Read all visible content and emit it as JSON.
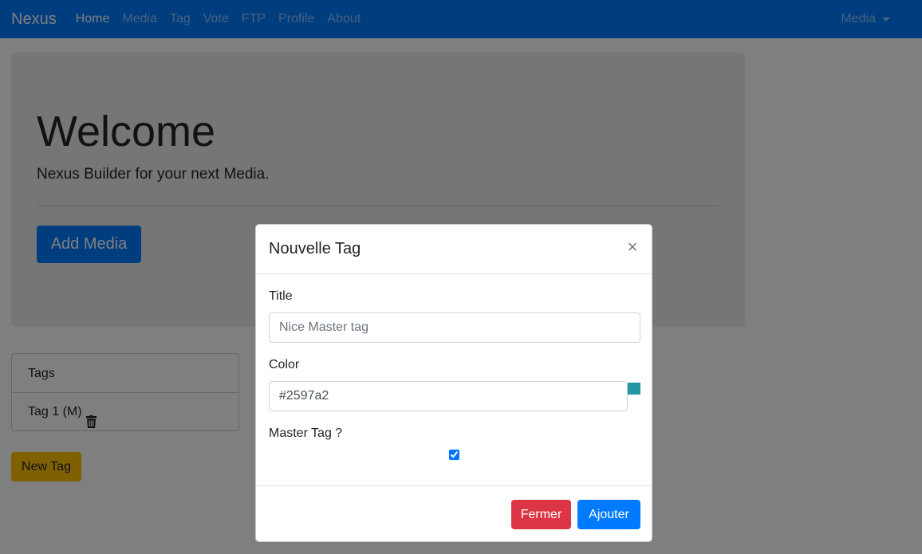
{
  "navbar": {
    "brand": "Nexus",
    "items": [
      "Home",
      "Media",
      "Tag",
      "Vote",
      "FTP",
      "Profile",
      "About"
    ],
    "active": "Home",
    "right_dropdown": "Media"
  },
  "jumbotron": {
    "title": "Welcome",
    "lead": "Nexus Builder for your next Media.",
    "button": "Add Media"
  },
  "tags": {
    "header": "Tags",
    "items": [
      {
        "label": "Tag 1 (M)",
        "icon": "trash-icon"
      }
    ],
    "new_button": "New Tag"
  },
  "modal": {
    "title": "Nouvelle Tag",
    "close_glyph": "×",
    "title_label": "Title",
    "title_placeholder": "Nice Master tag",
    "color_label": "Color",
    "color_value": "#2597a2",
    "master_label": "Master Tag ?",
    "master_checked": true,
    "cancel_button": "Fermer",
    "submit_button": "Ajouter"
  },
  "colors": {
    "primary": "#007bff",
    "danger": "#dc3545",
    "warning": "#ffc107",
    "swatch": "#2597a2"
  }
}
